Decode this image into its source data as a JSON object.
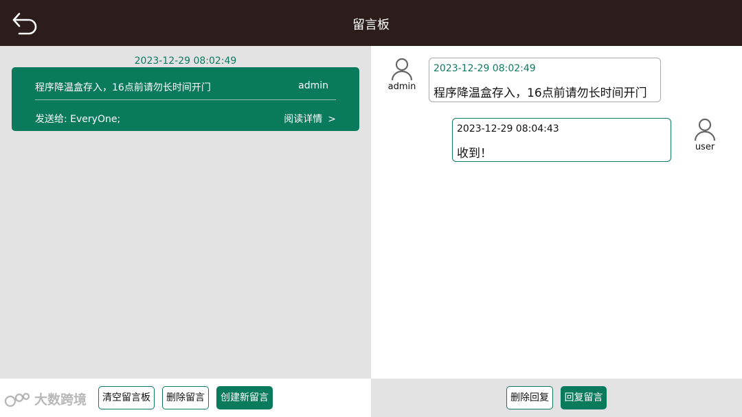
{
  "header": {
    "title": "留言板",
    "back_icon": "back-arrow-icon"
  },
  "message_list": {
    "items": [
      {
        "date": "2023-12-29 08:02:49",
        "text": "程序降温盒存入，16点前请勿长时间开门",
        "author": "admin",
        "recipients": "发送给: EveryOne;",
        "detail_label": "阅读详情",
        "detail_chevron": ">"
      }
    ]
  },
  "conversation": {
    "messages": [
      {
        "side": "left",
        "user": "admin",
        "time": "2023-12-29 08:02:49",
        "text": "程序降温盒存入，16点前请勿长时间开门",
        "time_color": "#0d7a5f",
        "border_color": "#a9a9a9"
      },
      {
        "side": "right",
        "user": "user",
        "time": "2023-12-29 08:04:43",
        "text": "收到！",
        "time_color": "#111111",
        "border_color": "#0a7a5c"
      }
    ]
  },
  "left_actions": {
    "clear_board": "清空留言板",
    "delete_message": "删除留言",
    "create_message": "创建新留言"
  },
  "right_actions": {
    "delete_reply": "删除回复",
    "reply_message": "回复留言"
  },
  "watermark": {
    "text": "大数跨境"
  },
  "colors": {
    "accent": "#0a7a5c",
    "topbar": "#2c1d1c",
    "panel_gray": "#e3e3e3"
  }
}
